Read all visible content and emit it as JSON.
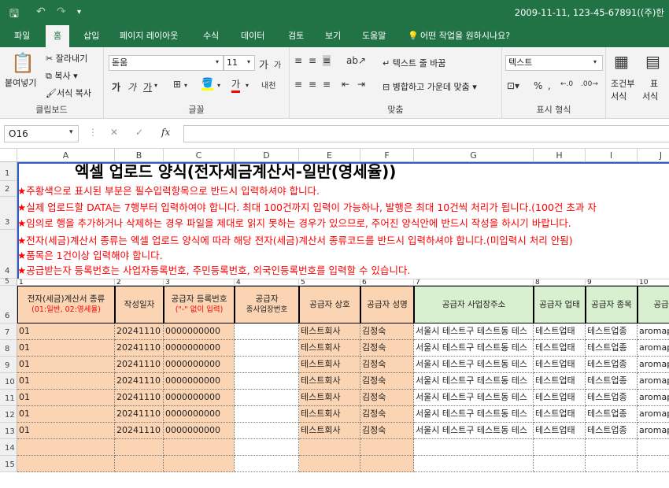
{
  "titlebar": {
    "title": "2009-11-11, 123-45-67891((주)한"
  },
  "ribbon_tabs": [
    "파일",
    "홈",
    "삽입",
    "페이지 레이아웃",
    "수식",
    "데이터",
    "검토",
    "보기",
    "도움말",
    "어떤 작업을 원하시나요?"
  ],
  "clipboard": {
    "paste": "붙여넣기",
    "cut": "잘라내기",
    "copy": "복사",
    "format_painter": "서식 복사",
    "label": "클립보드"
  },
  "font": {
    "name": "돋움",
    "size": "11",
    "label": "글꼴",
    "bold": "가",
    "italic": "가",
    "underline": "가",
    "grow": "가",
    "shrink": "가",
    "phonetic": "내천"
  },
  "alignment": {
    "wrap": "텍스트 줄 바꿈",
    "merge": "병합하고 가운데 맞춤",
    "label": "맞춤"
  },
  "number": {
    "format": "텍스트",
    "label": "표시 형식",
    "percent": "%",
    "comma": ","
  },
  "styles": {
    "cond1": "조건부",
    "cond2": "서식",
    "table1": "표",
    "table2": "서식"
  },
  "formula": {
    "cellref": "O16",
    "fx": "fx"
  },
  "columns": [
    "A",
    "B",
    "C",
    "D",
    "E",
    "F",
    "G",
    "H",
    "I",
    "J"
  ],
  "rows": [
    "1",
    "2",
    "3",
    "4",
    "5",
    "6",
    "7",
    "8",
    "9",
    "10",
    "11",
    "12",
    "13",
    "14",
    "15"
  ],
  "sheet": {
    "title": "엑셀 업로드 양식(전자세금계산서-일반(영세율))",
    "notes": [
      "★주황색으로 표시된 부분은 필수입력항목으로 반드시 입력하셔야 합니다.",
      "★실제 업로드할 DATA는 7행부터 입력하여야 합니다. 최대 100건까지 입력이 가능하나, 발행은 최대 10건씩 처리가 됩니다.(100건 초과 자",
      "★임의로 행을 추가하거나 삭제하는 경우 파일을 제대로 읽지 못하는 경우가 있으므로, 주어진 양식안에 반드시 작성을 하시기 바랍니다.",
      "★전자(세금)계산서 종류는 엑셀 업로드 양식에 따라 해당 전자(세금)계산서 종류코드를 반드시 입력하셔야 합니다.(미입력시 처리 안됨)",
      "★품목은 1건이상 입력해야 합니다.",
      "★공급받는자 등록번호는 사업자등록번호, 주민등록번호, 외국인등록번호를 입력할 수 있습니다."
    ],
    "row5": [
      "1",
      "2",
      "3",
      "4",
      "5",
      "6",
      "7",
      "8",
      "9",
      "10"
    ],
    "headers": [
      {
        "main": "전자(세금)계산서 종류",
        "sub": "(01:일반, 02:영세율)"
      },
      {
        "main": "작성일자",
        "sub": ""
      },
      {
        "main": "공급자 등록번호",
        "sub": "(\"-\" 없이 입력)"
      },
      {
        "main": "공급자",
        "sub": "종사업장번호"
      },
      {
        "main": "공급자 상호",
        "sub": ""
      },
      {
        "main": "공급자 성명",
        "sub": ""
      },
      {
        "main": "공급자 사업장주소",
        "sub": ""
      },
      {
        "main": "공급자 업태",
        "sub": ""
      },
      {
        "main": "공급자 종목",
        "sub": ""
      },
      {
        "main": "공급",
        "sub": ""
      }
    ],
    "data_rows": [
      [
        "01",
        "20241110",
        "0000000000",
        "",
        "테스트회사",
        "김정숙",
        "서울시 테스트구 테스트동 테스",
        "테스트업태",
        "테스트업종",
        "aromap"
      ],
      [
        "01",
        "20241110",
        "0000000000",
        "",
        "테스트회사",
        "김정숙",
        "서울시 테스트구 테스트동 테스",
        "테스트업태",
        "테스트업종",
        "aromap"
      ],
      [
        "01",
        "20241110",
        "0000000000",
        "",
        "테스트회사",
        "김정숙",
        "서울시 테스트구 테스트동 테스",
        "테스트업태",
        "테스트업종",
        "aromap"
      ],
      [
        "01",
        "20241110",
        "0000000000",
        "",
        "테스트회사",
        "김정숙",
        "서울시 테스트구 테스트동 테스",
        "테스트업태",
        "테스트업종",
        "aromap"
      ],
      [
        "01",
        "20241110",
        "0000000000",
        "",
        "테스트회사",
        "김정숙",
        "서울시 테스트구 테스트동 테스",
        "테스트업태",
        "테스트업종",
        "aromap"
      ],
      [
        "01",
        "20241110",
        "0000000000",
        "",
        "테스트회사",
        "김정숙",
        "서울시 테스트구 테스트동 테스",
        "테스트업태",
        "테스트업종",
        "aromap"
      ],
      [
        "01",
        "20241110",
        "0000000000",
        "",
        "테스트회사",
        "김정숙",
        "서울시 테스트구 테스트동 테스",
        "테스트업태",
        "테스트업종",
        "aromap"
      ]
    ]
  }
}
